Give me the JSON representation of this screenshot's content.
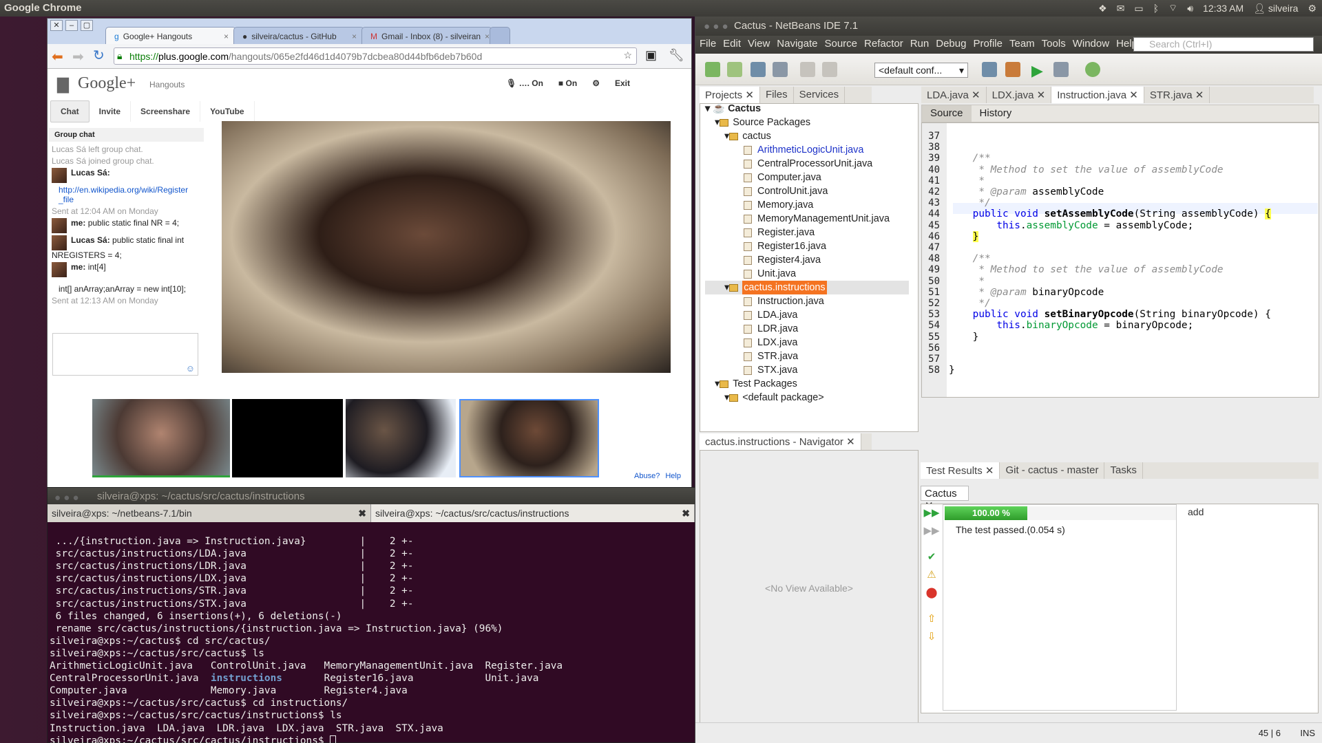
{
  "panel": {
    "app": "Google Chrome",
    "time": "12:33 AM",
    "user": "silveira"
  },
  "chrome": {
    "tabs": [
      {
        "label": "Google+ Hangouts"
      },
      {
        "label": "silveira/cactus - GitHub"
      },
      {
        "label": "Gmail - Inbox (8) - silveiran"
      }
    ],
    "url_host": "plus.google.com",
    "url_path": "/hangouts/065e2fd46d1d4079b7dcbea80d44bfb6deb7b60d",
    "url_scheme": "https://",
    "hangout": {
      "logo": "Google+",
      "product": "Hangouts",
      "mic": "On",
      "cam": "On",
      "exit": "Exit",
      "tabs": [
        "Chat",
        "Invite",
        "Screenshare",
        "YouTube"
      ],
      "group_chat": "Group chat",
      "log": {
        "l1": "Lucas Sá left group chat.",
        "l2": "Lucas Sá joined group chat.",
        "who1": "Lucas Sá:",
        "link": "http://en.wikipedia.org/wiki/Register_file",
        "sent1": "Sent at 12:04 AM on Monday",
        "who2": "me:",
        "m2": "public static final NR = 4;",
        "who3": "Lucas Sá:",
        "m3": "public static final int NREGISTERS = 4;",
        "who4": "me:",
        "m4": "int[4]",
        "m5": "int[] anArray;anArray = new int[10];",
        "sent2": "Sent at 12:13 AM on Monday"
      },
      "abuse": "Abuse?",
      "help": "Help"
    }
  },
  "terminal": {
    "title": "silveira@xps: ~/cactus/src/cactus/instructions",
    "tab1": "silveira@xps: ~/netbeans-7.1/bin",
    "tab2": "silveira@xps: ~/cactus/src/cactus/instructions",
    "lines": [
      " .../{instruction.java => Instruction.java}         |    2 +-",
      " src/cactus/instructions/LDA.java                   |    2 +-",
      " src/cactus/instructions/LDR.java                   |    2 +-",
      " src/cactus/instructions/LDX.java                   |    2 +-",
      " src/cactus/instructions/STR.java                   |    2 +-",
      " src/cactus/instructions/STX.java                   |    2 +-",
      " 6 files changed, 6 insertions(+), 6 deletions(-)",
      " rename src/cactus/instructions/{instruction.java => Instruction.java} (96%)",
      "silveira@xps:~/cactus$ cd src/cactus/",
      "silveira@xps:~/cactus/src/cactus$ ls",
      "ArithmeticLogicUnit.java   ControlUnit.java   MemoryManagementUnit.java  Register.java",
      "CentralProcessorUnit.java  ",
      "Computer.java              Memory.java        Register4.java",
      "silveira@xps:~/cactus/src/cactus$ cd instructions/",
      "silveira@xps:~/cactus/src/cactus/instructions$ ls",
      "Instruction.java  LDA.java  LDR.java  LDX.java  STR.java  STX.java",
      "silveira@xps:~/cactus/src/cactus/instructions$ "
    ],
    "dir_word": "instructions",
    "after_dir": "       Register16.java            Unit.java"
  },
  "netbeans": {
    "title": "Cactus - NetBeans IDE 7.1",
    "menu": [
      "File",
      "Edit",
      "View",
      "Navigate",
      "Source",
      "Refactor",
      "Run",
      "Debug",
      "Profile",
      "Team",
      "Tools",
      "Window",
      "Help"
    ],
    "search": "Search (Ctrl+I)",
    "config": "<default conf...",
    "project_tabs": [
      "Projects",
      "Files",
      "Services"
    ],
    "tree": {
      "root": "Cactus",
      "src": "Source Packages",
      "pkg": "cactus",
      "files": [
        "ArithmeticLogicUnit.java",
        "CentralProcessorUnit.java",
        "Computer.java",
        "ControlUnit.java",
        "Memory.java",
        "MemoryManagementUnit.java",
        "Register.java",
        "Register16.java",
        "Register4.java",
        "Unit.java"
      ],
      "pkg2": "cactus.instructions",
      "files2": [
        "Instruction.java",
        "LDA.java",
        "LDR.java",
        "LDX.java",
        "STR.java",
        "STX.java"
      ],
      "test": "Test Packages",
      "def": "<default package>"
    },
    "editor_tabs": [
      "LDA.java",
      "LDX.java",
      "Instruction.java",
      "STR.java"
    ],
    "source": "Source",
    "history": "History",
    "navigator": "cactus.instructions - Navigator",
    "no_view": "<No View Available>",
    "bottom_tabs": [
      "Test Results",
      "Git - cactus - master",
      "Tasks"
    ],
    "results_tab": "Cactus",
    "progress": "100.00 %",
    "progress_value": 1.0,
    "passed": "The test passed.(0.054 s)",
    "add": "add",
    "status_pos": "45 | 6",
    "status_mode": "INS",
    "lines": [
      "37",
      "38",
      "39",
      "40",
      "41",
      "42",
      "43",
      "44",
      "45",
      "46",
      "47",
      "48",
      "49",
      "50",
      "51",
      "52",
      "53",
      "54",
      "55",
      "56",
      "57",
      "58"
    ]
  }
}
